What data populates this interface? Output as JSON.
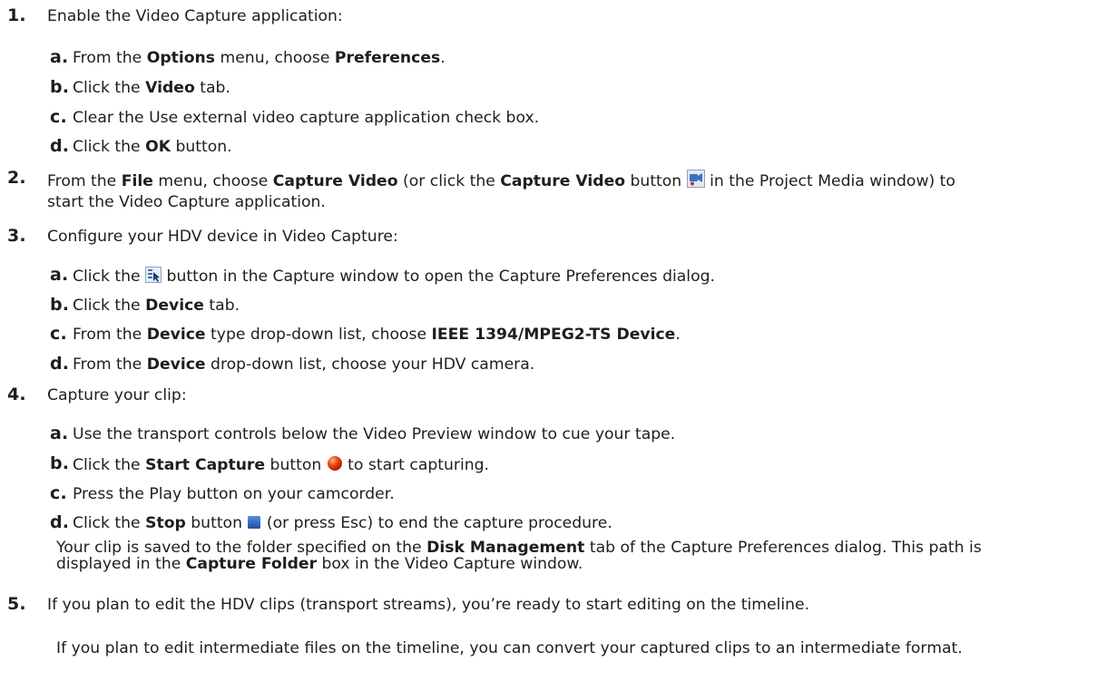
{
  "step1": {
    "num": "1.",
    "text": "Enable the Video Capture application:",
    "a": {
      "letter": "a.",
      "t1": "From the ",
      "b1": "Options",
      "t2": " menu, choose ",
      "b2": "Preferences",
      "t3": "."
    },
    "b": {
      "letter": "b.",
      "t1": "Click the ",
      "b1": "Video",
      "t2": " tab."
    },
    "c": {
      "letter": "c.",
      "t1": "Clear the Use external video capture application check box."
    },
    "d": {
      "letter": "d.",
      "t1": "Click the ",
      "b1": "OK",
      "t2": " button."
    }
  },
  "step2": {
    "num": "2.",
    "t1": "From the ",
    "b1": "File",
    "t2": " menu, choose ",
    "b2": "Capture Video",
    "t3": " (or click the ",
    "b3": "Capture Video",
    "t4": " button ",
    "t5": " in the Project Media window) to",
    "line2": "start the Video Capture application."
  },
  "step3": {
    "num": "3.",
    "text": "Configure your HDV device in Video Capture:",
    "a": {
      "letter": "a.",
      "t1": "Click the ",
      "t2": " button in the Capture window to open the Capture Preferences dialog."
    },
    "b": {
      "letter": "b.",
      "t1": "Click the ",
      "b1": "Device",
      "t2": " tab."
    },
    "c": {
      "letter": "c.",
      "t1": "From the ",
      "b1": "Device",
      "t2": " type drop-down list, choose ",
      "b2": "IEEE 1394/MPEG2-TS Device",
      "t3": "."
    },
    "d": {
      "letter": "d.",
      "t1": "From the ",
      "b1": "Device",
      "t2": " drop-down list, choose your HDV camera."
    }
  },
  "step4": {
    "num": "4.",
    "text": "Capture your clip:",
    "a": {
      "letter": "a.",
      "t1": "Use the transport controls below the Video Preview window to cue your tape."
    },
    "b": {
      "letter": "b.",
      "t1": "Click the ",
      "b1": "Start Capture",
      "t2": " button ",
      "t3": " to start capturing."
    },
    "c": {
      "letter": "c.",
      "t1": "Press the Play button on your camcorder."
    },
    "d": {
      "letter": "d.",
      "t1": "Click the ",
      "b1": "Stop",
      "t2": " button ",
      "t3": " (or press Esc) to end the capture procedure."
    },
    "note": {
      "t1": "Your clip is saved to the folder specified on the ",
      "b1": "Disk Management",
      "t2": " tab of the Capture Preferences dialog. This path is",
      "t3": "displayed in the ",
      "b2": "Capture Folder",
      "t4": " box in the Video Capture window."
    }
  },
  "step5": {
    "num": "5.",
    "text": "If you plan to edit the HDV clips (transport streams), you’re ready to start editing on the timeline.",
    "extra": "If you plan to edit intermediate files on the timeline, you can convert your captured clips to an intermediate format."
  },
  "icons": {
    "capture_video": "capture-video-icon",
    "capture_prefs": "capture-preferences-icon",
    "start_capture": "record-icon",
    "stop": "stop-icon"
  },
  "colors": {
    "record": "#e8400c",
    "stop": "#2d62b8"
  }
}
